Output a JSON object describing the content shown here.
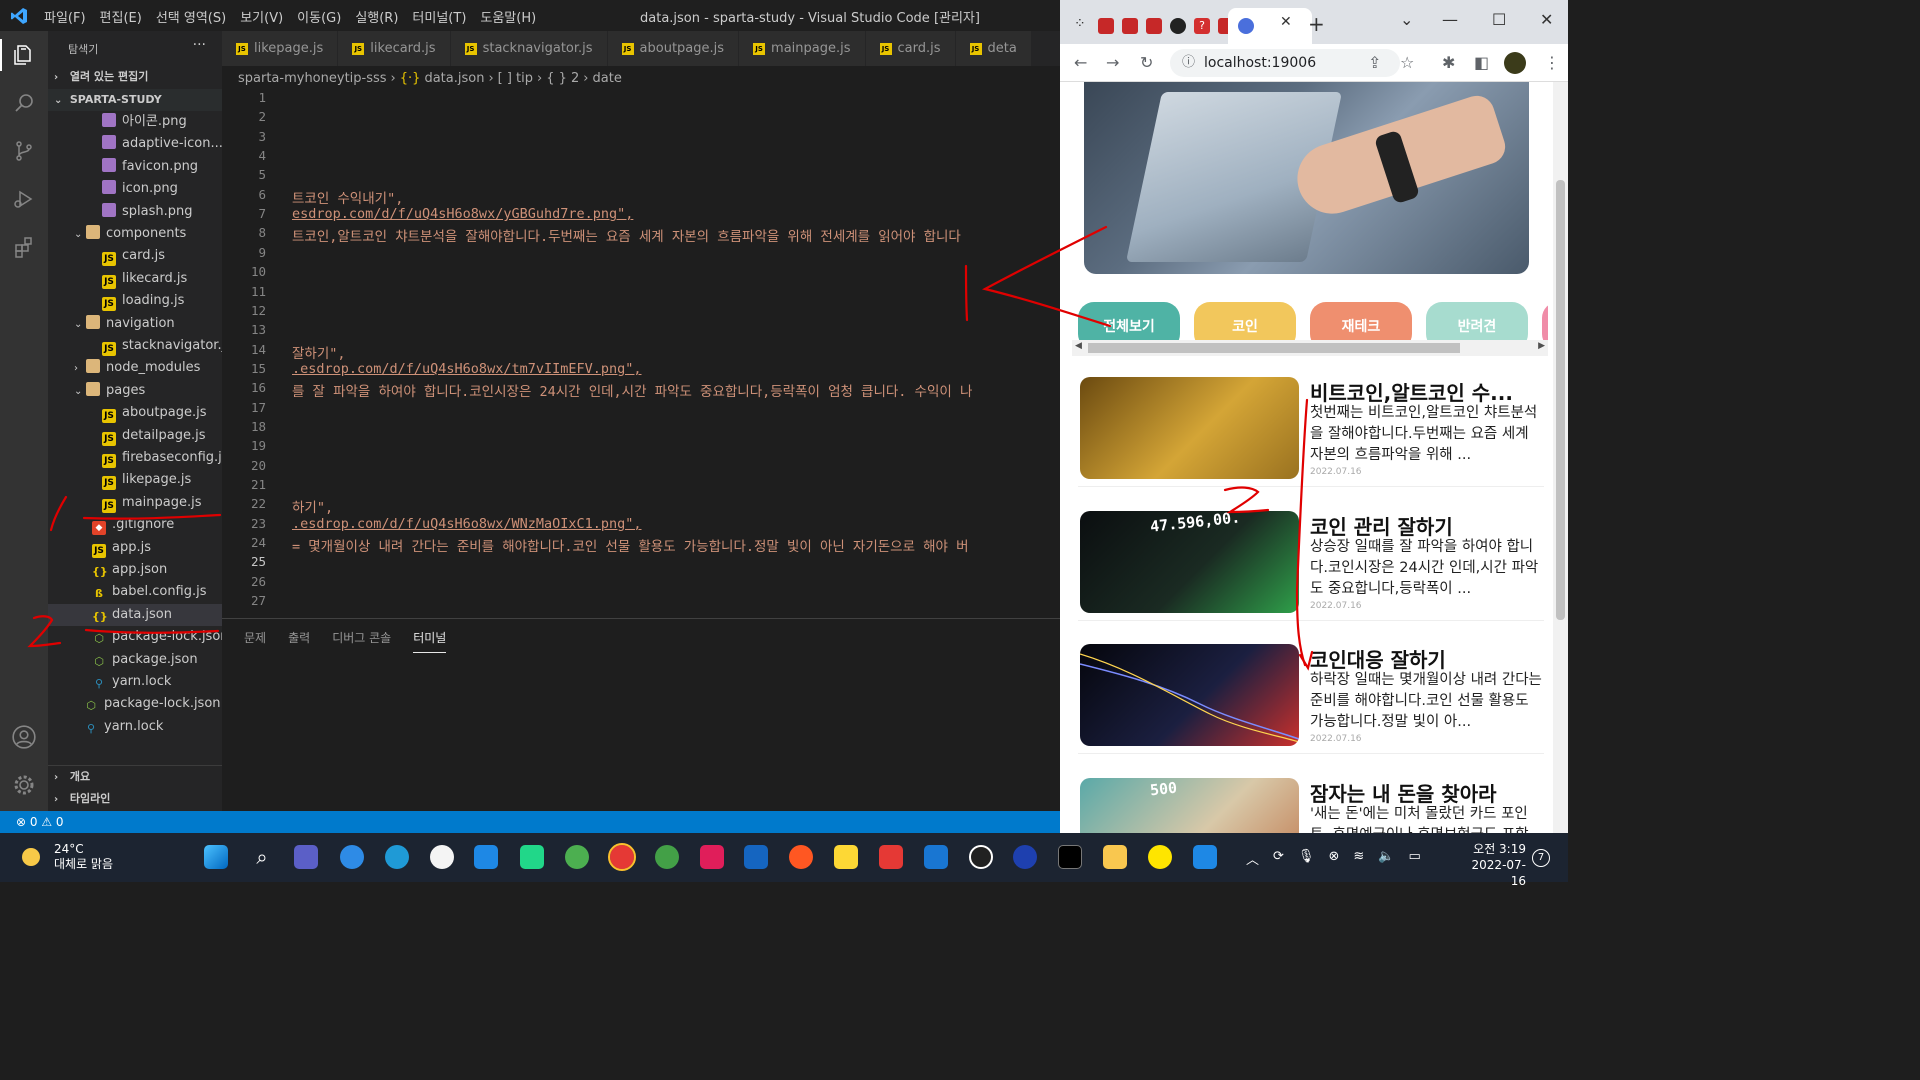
{
  "vscode": {
    "menu": [
      "파일(F)",
      "편집(E)",
      "선택 영역(S)",
      "보기(V)",
      "이동(G)",
      "실행(R)",
      "터미널(T)",
      "도움말(H)"
    ],
    "window_title": "data.json - sparta-study - Visual Studio Code [관리자]",
    "explorer": {
      "header": "탐색기",
      "more": "···",
      "open_editors": "열려 있는 편집기",
      "project": "SPARTA-STUDY",
      "outline": "개요",
      "timeline": "타임라인"
    },
    "tree": [
      {
        "label": "아이콘.png",
        "type": "img",
        "depth": 2
      },
      {
        "label": "adaptive-icon....",
        "type": "img",
        "depth": 2
      },
      {
        "label": "favicon.png",
        "type": "img",
        "depth": 2
      },
      {
        "label": "icon.png",
        "type": "img",
        "depth": 2
      },
      {
        "label": "splash.png",
        "type": "img",
        "depth": 2
      },
      {
        "label": "components",
        "type": "folder",
        "depth": 1,
        "chev": "⌄"
      },
      {
        "label": "card.js",
        "type": "js",
        "depth": 2
      },
      {
        "label": "likecard.js",
        "type": "js",
        "depth": 2
      },
      {
        "label": "loading.js",
        "type": "js",
        "depth": 2
      },
      {
        "label": "navigation",
        "type": "folder",
        "depth": 1,
        "chev": "⌄"
      },
      {
        "label": "stacknavigator.js",
        "type": "js",
        "depth": 2
      },
      {
        "label": "node_modules",
        "type": "folder",
        "depth": 1,
        "chev": "›"
      },
      {
        "label": "pages",
        "type": "folder",
        "depth": 1,
        "chev": "⌄"
      },
      {
        "label": "aboutpage.js",
        "type": "js",
        "depth": 2
      },
      {
        "label": "detailpage.js",
        "type": "js",
        "depth": 2
      },
      {
        "label": "firebaseconfig.js",
        "type": "js",
        "depth": 2
      },
      {
        "label": "likepage.js",
        "type": "js",
        "depth": 2
      },
      {
        "label": "mainpage.js",
        "type": "js",
        "depth": 2
      },
      {
        "label": ".gitignore",
        "type": "git",
        "depth": 1
      },
      {
        "label": "app.js",
        "type": "js",
        "depth": 1
      },
      {
        "label": "app.json",
        "type": "json",
        "depth": 1
      },
      {
        "label": "babel.config.js",
        "type": "babel",
        "depth": 1
      },
      {
        "label": "data.json",
        "type": "json",
        "depth": 1,
        "selected": true
      },
      {
        "label": "package-lock.json",
        "type": "node",
        "depth": 1
      },
      {
        "label": "package.json",
        "type": "node",
        "depth": 1
      },
      {
        "label": "yarn.lock",
        "type": "yarn",
        "depth": 1
      },
      {
        "label": "package-lock.json",
        "type": "node",
        "depth": 0
      },
      {
        "label": "yarn.lock",
        "type": "yarn",
        "depth": 0
      }
    ],
    "tabs": [
      "likepage.js",
      "likecard.js",
      "stacknavigator.js",
      "aboutpage.js",
      "mainpage.js",
      "card.js",
      "deta"
    ],
    "breadcrumb": {
      "folder": "sparta-myhoneytip-sss",
      "file": "data.json",
      "arr": "[ ] tip",
      "obj": "{ } 2",
      "key": "date"
    },
    "line_numbers": [
      "1",
      "2",
      "3",
      "4",
      "5",
      "6",
      "7",
      "8",
      "9",
      "10",
      "11",
      "12",
      "13",
      "14",
      "15",
      "16",
      "17",
      "18",
      "19",
      "20",
      "21",
      "22",
      "23",
      "24",
      "25",
      "26",
      "27"
    ],
    "current_line": "25",
    "code_lines": [
      {
        "line": 6,
        "text": "트코인 수익내기\","
      },
      {
        "line": 7,
        "text": "esdrop.com/d/f/uQ4sH6o8wx/yGBGuhd7re.png\",",
        "link": true
      },
      {
        "line": 8,
        "text": "트코인,알트코인 챠트분석을 잘해야합니다.두번째는 요즘 세계 자본의 흐름파악을 위해 전세계를 읽어야 합니다"
      },
      {
        "line": 14,
        "text": "잘하기\","
      },
      {
        "line": 15,
        "text": ".esdrop.com/d/f/uQ4sH6o8wx/tm7vIImEFV.png\",",
        "link": true
      },
      {
        "line": 16,
        "text": "를 잘 파악을 하여야 합니다.코인시장은 24시간 인데,시간 파악도 중요합니다,등락폭이 엄청 큽니다. 수익이 나"
      },
      {
        "line": 22,
        "text": "하기\","
      },
      {
        "line": 23,
        "text": ".esdrop.com/d/f/uQ4sH6o8wx/WNzMaOIxC1.png\",",
        "link": true
      },
      {
        "line": 24,
        "text": "= 몇개월이상 내려 간다는 준비를 해야합니다.코인 선물 활용도 가능합니다.정말 빛이 아닌 자기돈으로 해야 버"
      }
    ],
    "panel_tabs": [
      "문제",
      "출력",
      "디버그 콘솔",
      "터미널"
    ],
    "status": "⊗ 0 ⚠ 0"
  },
  "chrome": {
    "url": "localhost:19006",
    "categories": [
      {
        "label": "전체보기",
        "color": "#4fb3a5"
      },
      {
        "label": "코인",
        "color": "#f2c75c"
      },
      {
        "label": "재테크",
        "color": "#ef8f6f"
      },
      {
        "label": "반려견",
        "color": "#a7dccf"
      }
    ],
    "cards": [
      {
        "title": "비트코인,알트코인 수...",
        "desc": "첫번째는 비트코인,알트코인 챠트분석을 잘해야합니다.두번째는 요즘 세계 자본의 흐름파악을 위해 ...",
        "date": "2022.07.16",
        "thumb_colors": [
          "#6b4a10",
          "#d4a536",
          "#9a7220"
        ]
      },
      {
        "title": "코인 관리 잘하기",
        "desc": "상승장 일때를 잘 파악을 하여야 합니다.코인시장은 24시간 인데,시간 파악도 중요합니다,등락폭이 ...",
        "date": "2022.07.16",
        "thumb_colors": [
          "#0b0e10",
          "#1a2a22",
          "#2fa04a"
        ],
        "thumb_text": "47.596,00."
      },
      {
        "title": "코인대응 잘하기",
        "desc": "하락장 일때는 몇개월이상 내려 간다는 준비를 해야합니다.코인 선물 활용도 가능합니다.정말 빛이 아...",
        "date": "2022.07.16",
        "thumb_colors": [
          "#05060c",
          "#1b1f40",
          "#c9302c"
        ]
      },
      {
        "title": "잠자는 내 돈을 찾아라",
        "desc": "'새는 돈'에는 미처 몰랐던 카드 포인트, 휴면예금이나 휴면보험금도 포함",
        "date": "",
        "thumb_colors": [
          "#5aa9a8",
          "#d8c8a8",
          "#c07a50"
        ],
        "thumb_text": "500"
      }
    ]
  },
  "taskbar": {
    "weather_temp": "24°C",
    "weather_desc": "대체로 맑음",
    "time": "오전 3:19",
    "date": "2022-07-16",
    "notif_count": "7"
  }
}
